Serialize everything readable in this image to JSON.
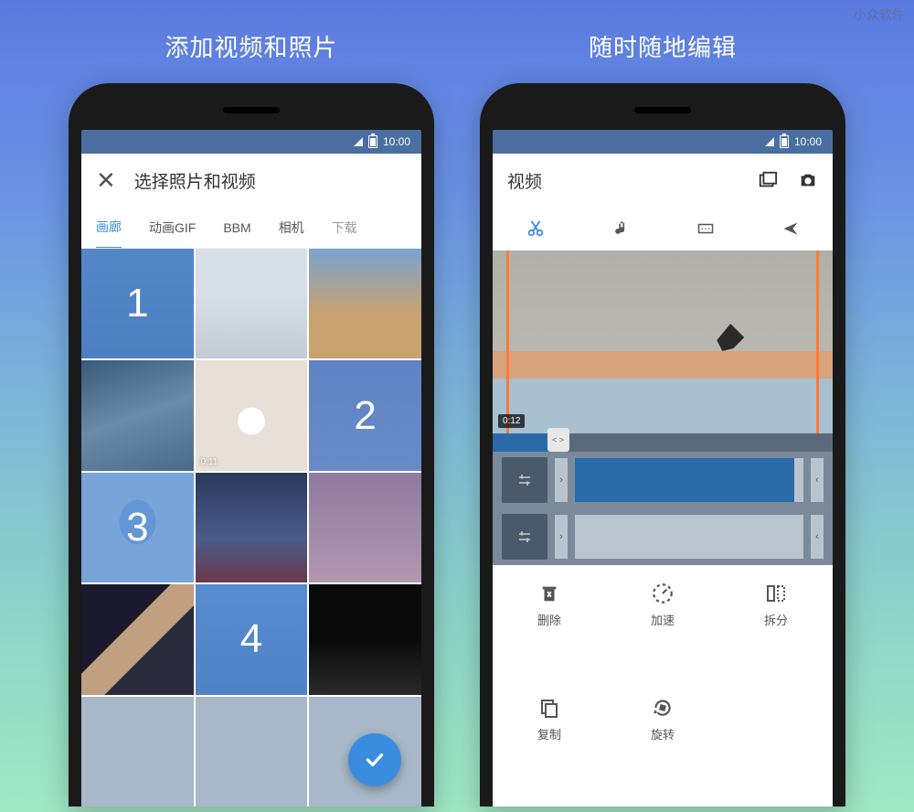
{
  "watermark": "小众软件",
  "captions": {
    "left": "添加视频和照片",
    "right": "随时随地编辑"
  },
  "statusbar": {
    "time": "10:00"
  },
  "picker": {
    "title": "选择照片和视频",
    "tabs": [
      "画廊",
      "动画GIF",
      "BBM",
      "相机",
      "下载"
    ],
    "active_tab": 0,
    "selections": {
      "0": "1",
      "5": "2",
      "6": "3",
      "10": "4"
    },
    "durations": {
      "4": "0:11"
    }
  },
  "editor": {
    "title": "视频",
    "preview_timestamp": "0:12",
    "scrub_handle": "< >",
    "tools": [
      {
        "key": "delete",
        "label": "删除"
      },
      {
        "key": "speed",
        "label": "加速"
      },
      {
        "key": "split",
        "label": "拆分"
      },
      {
        "key": "copy",
        "label": "复制"
      },
      {
        "key": "rotate",
        "label": "旋转"
      }
    ]
  }
}
